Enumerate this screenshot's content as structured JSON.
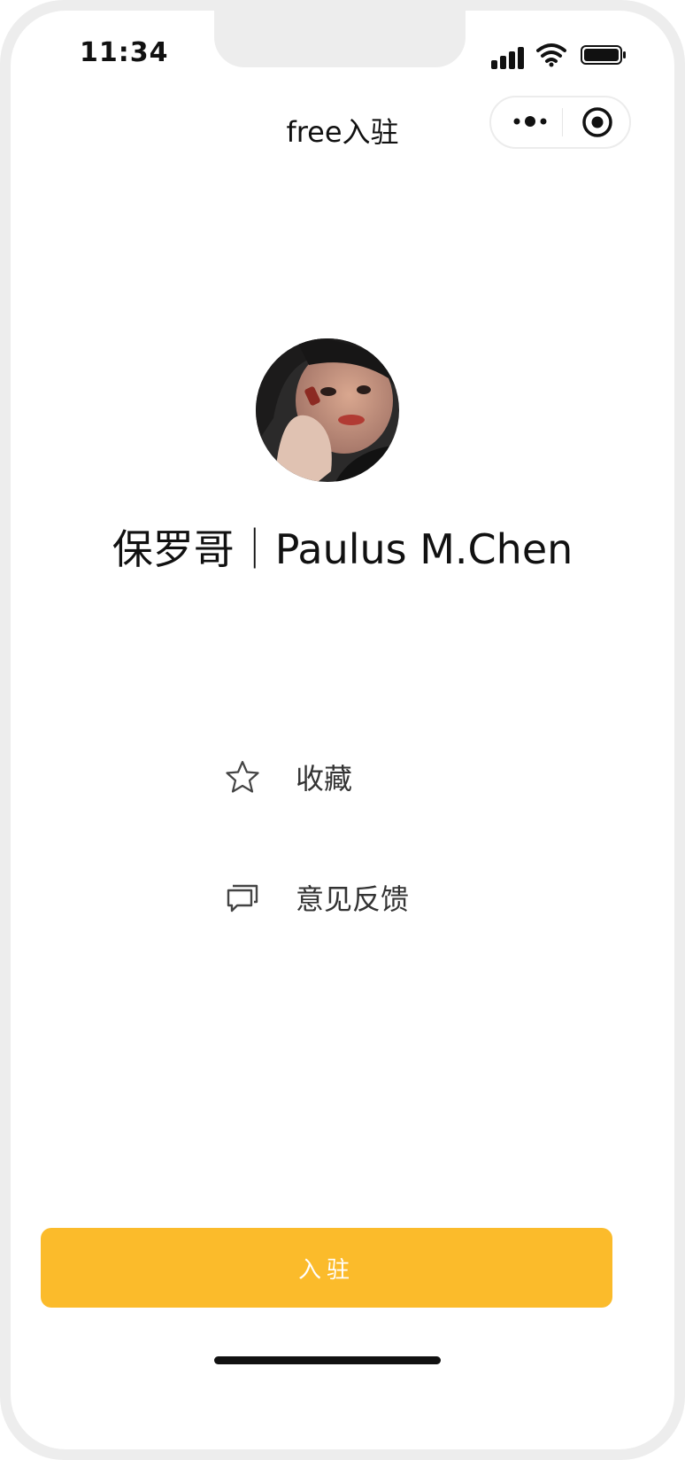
{
  "status_bar": {
    "time": "11:34"
  },
  "nav": {
    "title": "free入驻"
  },
  "profile": {
    "name": "保罗哥｜Paulus M.Chen"
  },
  "menu": [
    {
      "icon": "star-icon",
      "label": "收藏"
    },
    {
      "icon": "chat-bubble-icon",
      "label": "意见反馈"
    }
  ],
  "primary_button": {
    "label": "入驻",
    "color": "#fbbb2b"
  }
}
